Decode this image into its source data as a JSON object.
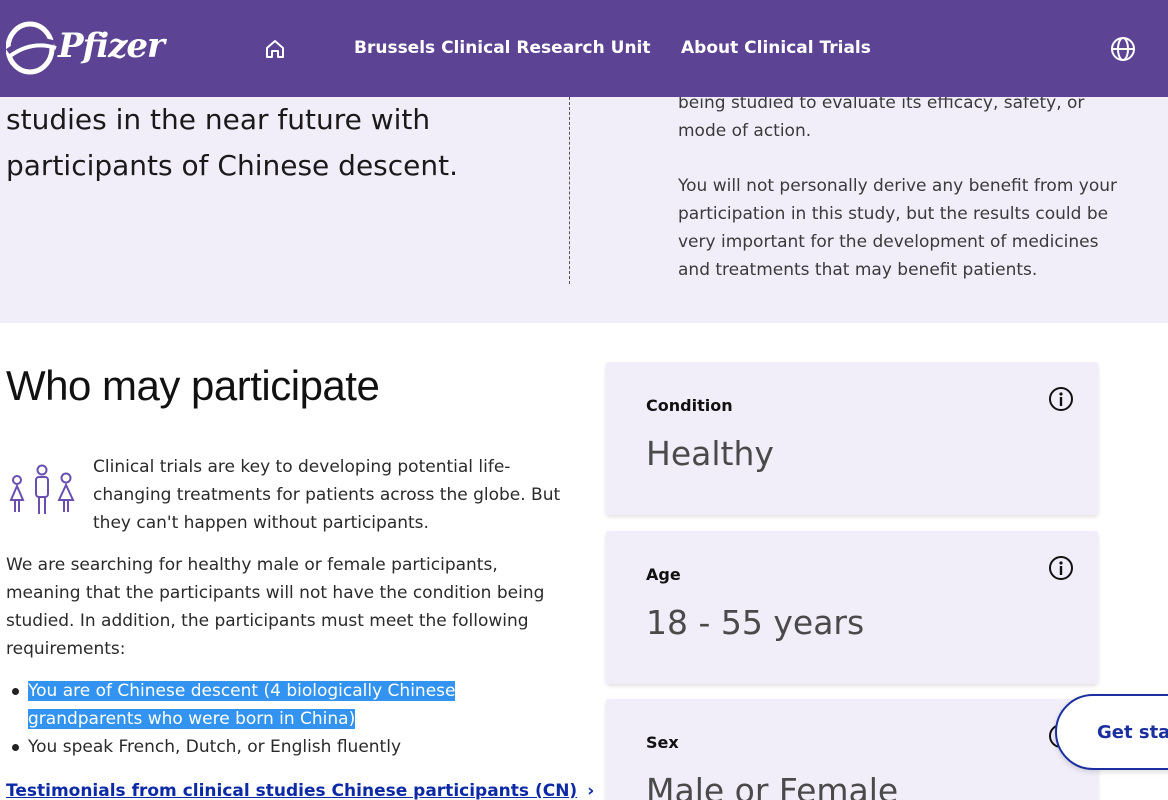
{
  "header": {
    "logo_text": "Pfizer",
    "nav": [
      "Brussels Clinical Research Unit",
      "About Clinical Trials"
    ],
    "home_icon": "home-icon",
    "globe_icon": "globe-icon"
  },
  "intro": {
    "heading_partial": "studies in the near future with participants of Chinese descent.",
    "para1": "being studied to evaluate its efficacy, safety, or mode of action.",
    "para2": "You will not personally derive any benefit from your participation in this study, but the results could be very important for the development of medicines and treatments that may benefit patients."
  },
  "participate": {
    "title": "Who may participate",
    "intro_text": "Clinical trials are key to developing potential life-changing treatments for patients across the globe. But they can't happen without participants.",
    "search_text": "We are searching for healthy male or female participants, meaning that the participants will not have the condition being studied. In addition, the participants must meet the following requirements:",
    "requirements": [
      "You are of Chinese descent (4 biologically Chinese grandparents who were born in China)",
      "You speak French, Dutch, or English fluently"
    ],
    "link_text": "Testimonials from clinical studies Chinese participants (CN)",
    "link_chevron": "›"
  },
  "criteria": [
    {
      "label": "Condition",
      "value": "Healthy"
    },
    {
      "label": "Age",
      "value": "18 - 55 years"
    },
    {
      "label": "Sex",
      "value": "Male or Female"
    }
  ],
  "cta": {
    "label": "Get started"
  },
  "colors": {
    "brand": "#5c4393",
    "lavender": "#f1eefa",
    "link": "#0d2aa6",
    "highlight": "#3393f0"
  }
}
